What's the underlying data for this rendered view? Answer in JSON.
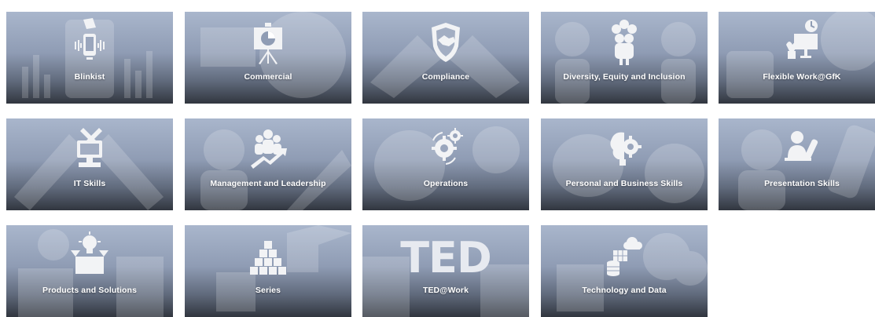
{
  "tiles": [
    {
      "label": "Blinkist",
      "icon": "phone-book-icon"
    },
    {
      "label": "Commercial",
      "icon": "presentation-chart-icon"
    },
    {
      "label": "Compliance",
      "icon": "shield-handshake-icon"
    },
    {
      "label": "Diversity, Equity and Inclusion",
      "icon": "diverse-people-icon"
    },
    {
      "label": "Flexible Work@GfK",
      "icon": "monitor-plant-icon"
    },
    {
      "label": "IT Skills",
      "icon": "computer-tools-icon"
    },
    {
      "label": "Management and Leadership",
      "icon": "leader-growth-icon"
    },
    {
      "label": "Operations",
      "icon": "gears-icon"
    },
    {
      "label": "Personal and Business Skills",
      "icon": "brain-gear-icon"
    },
    {
      "label": "Presentation Skills",
      "icon": "presenter-remote-icon"
    },
    {
      "label": "Products and Solutions",
      "icon": "lightbulb-box-icon"
    },
    {
      "label": "Series",
      "icon": "stacked-cubes-icon"
    },
    {
      "label": "TED@Work",
      "icon": "ted-logo",
      "logo_text": "TED"
    },
    {
      "label": "Technology and Data",
      "icon": "cloud-database-icon"
    }
  ]
}
